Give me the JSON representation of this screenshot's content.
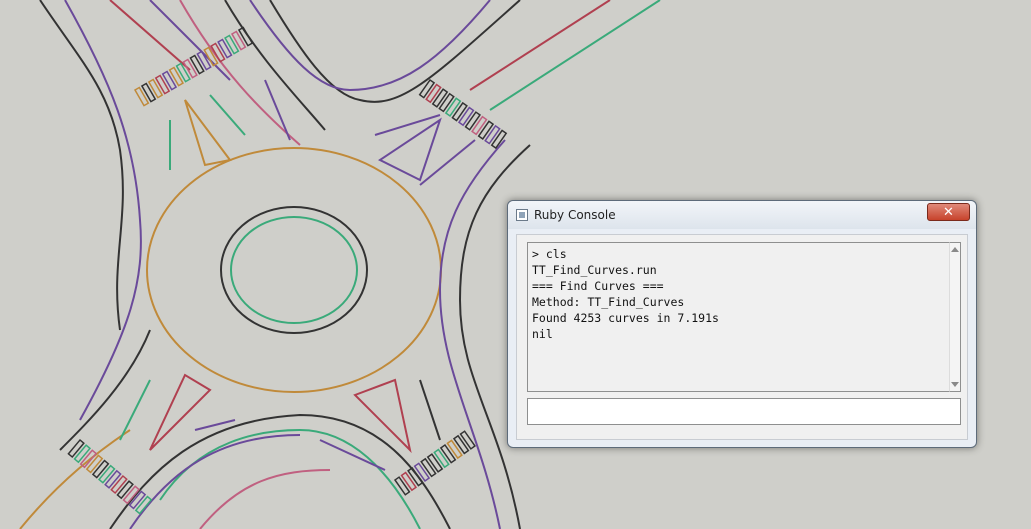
{
  "console": {
    "title": "Ruby Console",
    "close_symbol": "✕",
    "output_lines": [
      "> cls",
      "TT_Find_Curves.run",
      "=== Find Curves ===",
      "Method: TT_Find_Curves",
      "Found 4253 curves in 7.191s",
      "nil"
    ],
    "input_value": ""
  },
  "colors": {
    "background": "#cfcfca",
    "road_edge": "#4a4a48",
    "purple": "#6a4a9a",
    "orange": "#c08a3a",
    "green": "#3aaa7a",
    "red": "#b04050",
    "pink": "#c06080",
    "close_button": "#c7432c"
  },
  "icons": {
    "app": "ruby-console-icon",
    "close": "close-icon"
  }
}
